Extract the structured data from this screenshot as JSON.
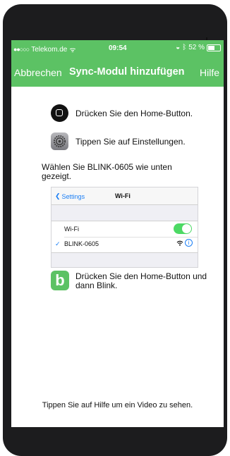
{
  "status_bar": {
    "signal_dots": "●●○○○",
    "carrier": "Telekom.de",
    "wifi_glyph": "ᯤ",
    "time": "09:54",
    "battery_text": "52 %"
  },
  "nav_bar": {
    "cancel_label": "Abbrechen",
    "title": "Sync-Modul hinzufügen",
    "help_label": "Hilfe"
  },
  "steps": {
    "step1": "Drücken Sie den Home-Button.",
    "step2": "Tippen Sie auf Einstellungen.",
    "instruction": "Wählen Sie BLINK-0605 wie unten gezeigt.",
    "step4": "Drücken Sie den Home-Button und dann Blink.",
    "blink_letter": "b"
  },
  "settings_preview": {
    "back_label": "Settings",
    "screen_title": "Wi-Fi",
    "wifi_row_label": "Wi-Fi",
    "network_name": "BLINK-0605",
    "checkmark": "✓",
    "info_glyph": "i"
  },
  "footer": {
    "text": "Tippen Sie auf Hilfe um ein Video zu sehen."
  },
  "colors": {
    "accent_green": "#5cc264",
    "ios_blue": "#1a7ef5",
    "device_frame": "#1c1c1e"
  }
}
